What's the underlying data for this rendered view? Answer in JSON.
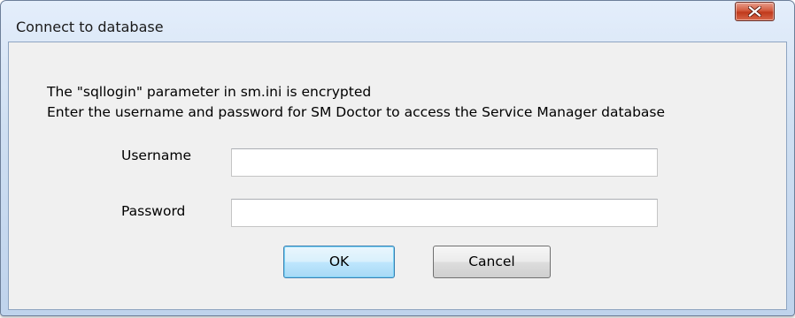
{
  "window": {
    "title": "Connect to database",
    "close_icon": "close-x-icon"
  },
  "message": {
    "line1": "The \"sqllogin\" parameter in sm.ini is encrypted",
    "line2": "Enter the username and password for SM Doctor to access the Service Manager database"
  },
  "form": {
    "username_label": "Username",
    "username_value": "",
    "password_label": "Password",
    "password_value": ""
  },
  "buttons": {
    "ok_label": "OK",
    "cancel_label": "Cancel"
  },
  "colors": {
    "close_button": "#c8442a",
    "ok_button_border": "#3c7fb1",
    "dialog_background": "#f0f0f0"
  }
}
